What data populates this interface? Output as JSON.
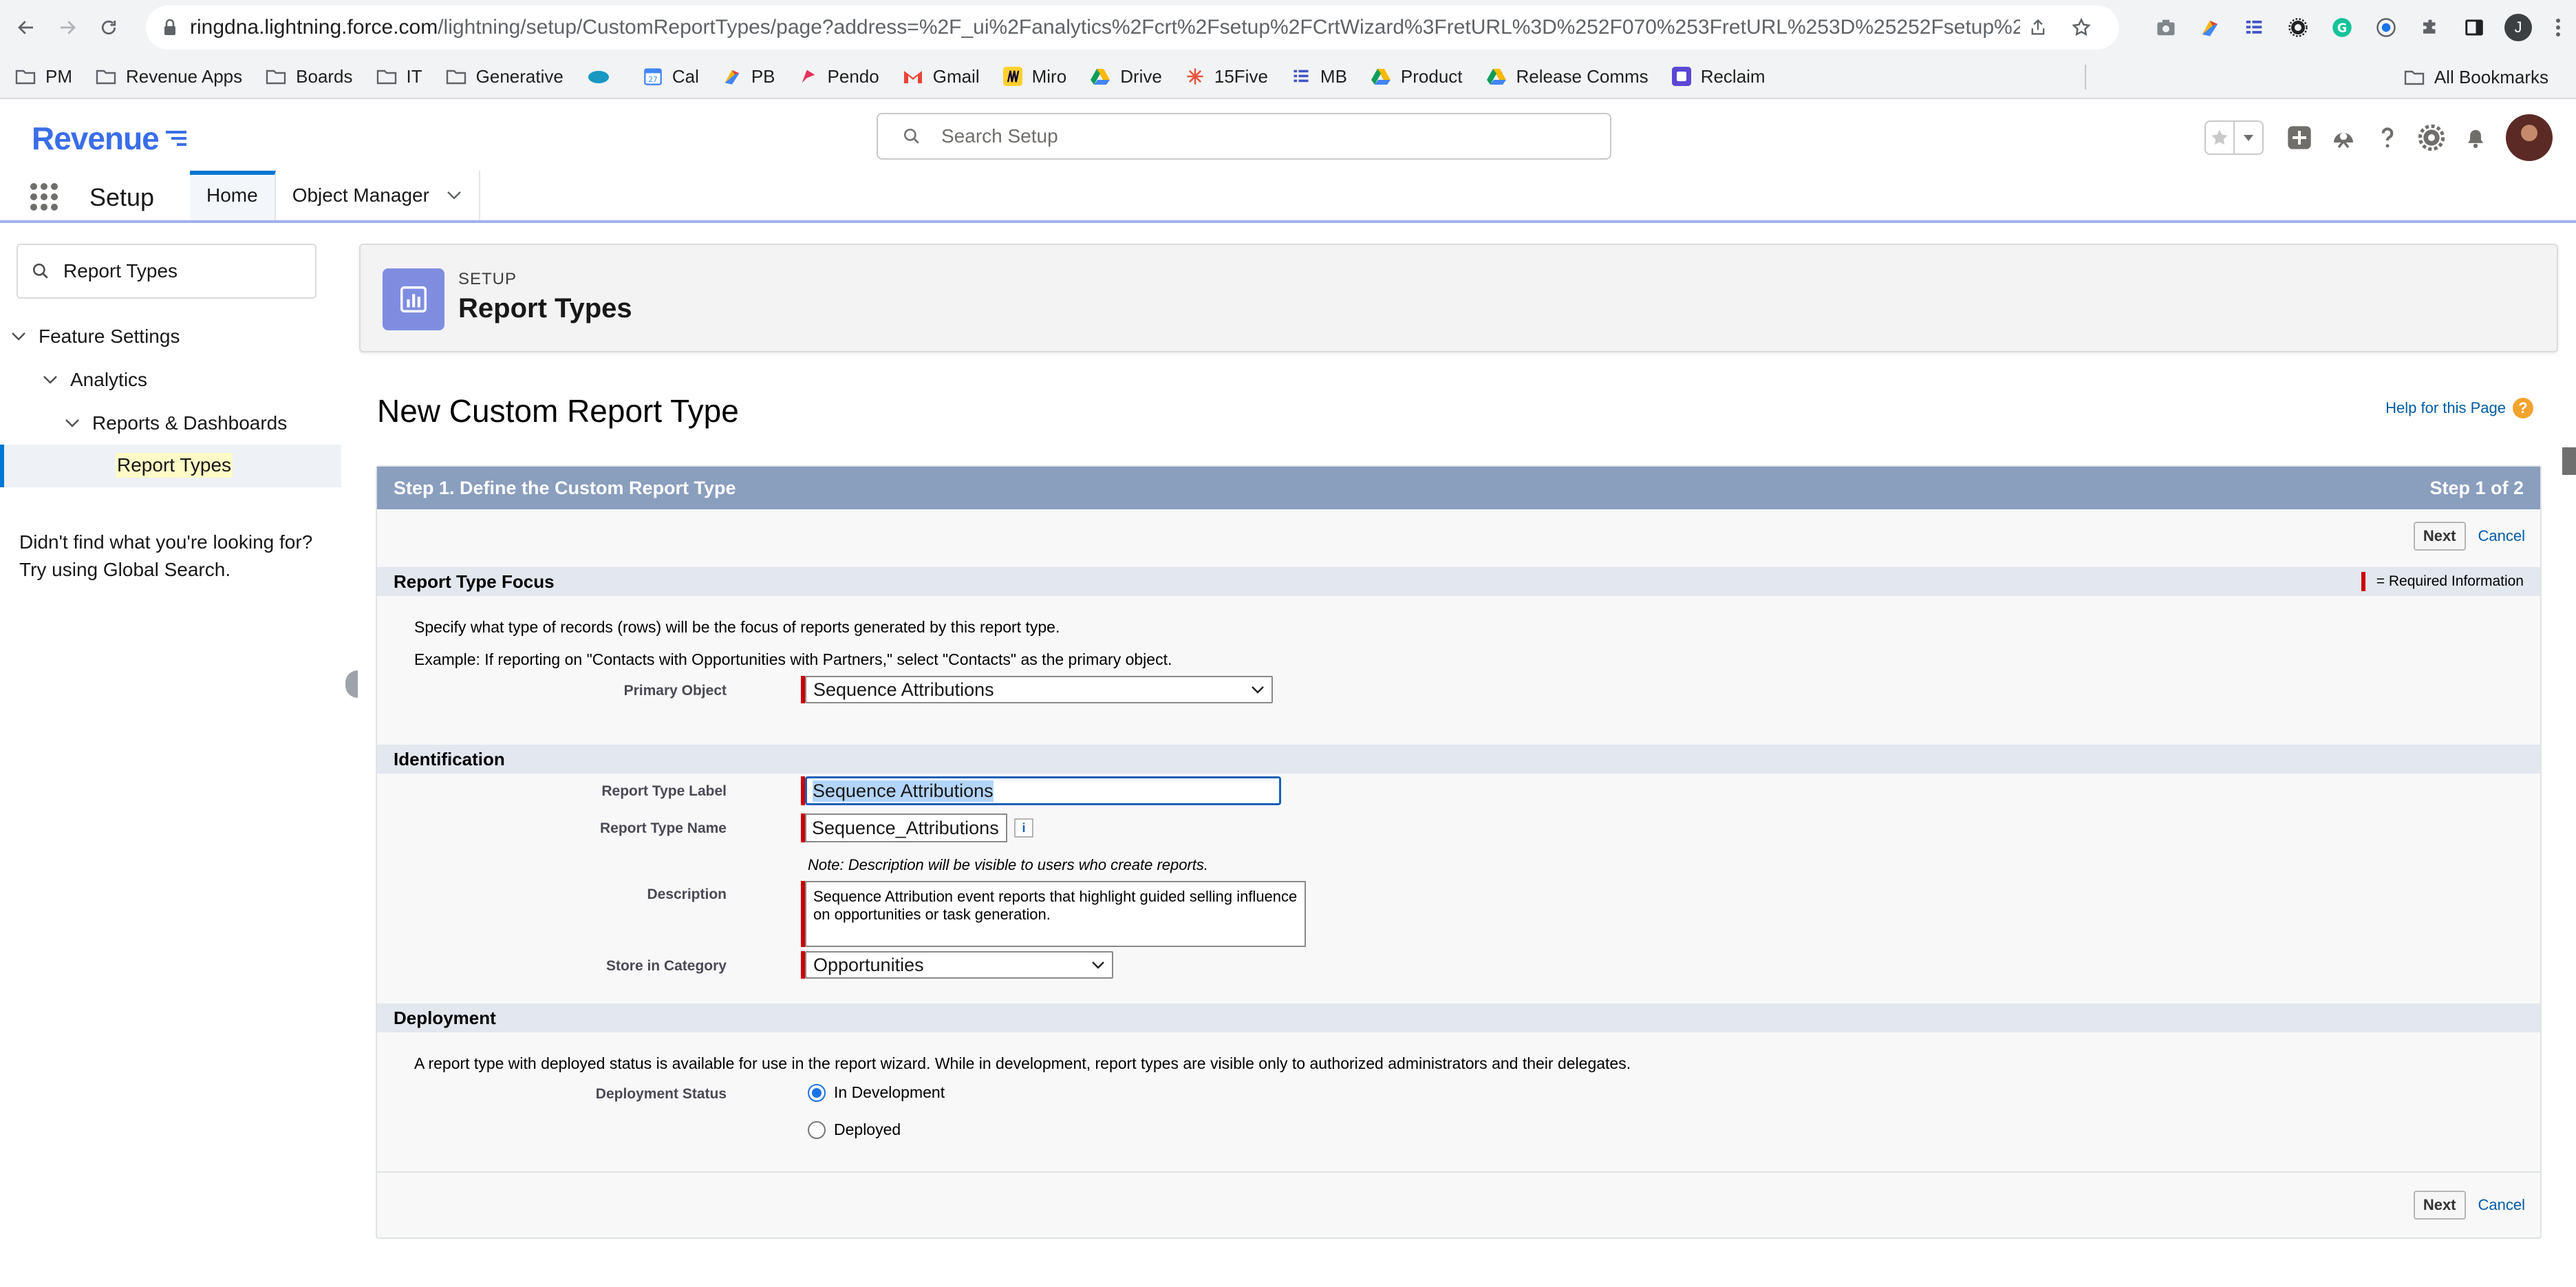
{
  "browser": {
    "url_host": "ringdna.lightning.force.com",
    "url_path": "/lightning/setup/CustomReportTypes/page?address=%2F_ui%2Fanalytics%2Fcrt%2Fsetup%2FCrtWizard%3FretURL%3D%252F070%253FretURL%253D%25252Fsetup%2...",
    "profile_initial": "J",
    "bookmarks": [
      {
        "label": "PM",
        "icon": "folder-icon"
      },
      {
        "label": "Revenue Apps",
        "icon": "folder-icon"
      },
      {
        "label": "Boards",
        "icon": "folder-icon"
      },
      {
        "label": "IT",
        "icon": "folder-icon"
      },
      {
        "label": "Generative",
        "icon": "folder-icon"
      },
      {
        "label": "",
        "icon": "salesforce-cloud-icon"
      },
      {
        "label": "Cal",
        "icon": "calendar-icon"
      },
      {
        "label": "PB",
        "icon": "pb-icon"
      },
      {
        "label": "Pendo",
        "icon": "pendo-icon"
      },
      {
        "label": "Gmail",
        "icon": "gmail-icon"
      },
      {
        "label": "Miro",
        "icon": "miro-icon"
      },
      {
        "label": "Drive",
        "icon": "drive-icon"
      },
      {
        "label": "15Five",
        "icon": "fifteen-five-icon"
      },
      {
        "label": "MB",
        "icon": "mb-icon"
      },
      {
        "label": "Product",
        "icon": "drive-icon"
      },
      {
        "label": "Release Comms",
        "icon": "drive-icon"
      },
      {
        "label": "Reclaim",
        "icon": "reclaim-icon"
      }
    ],
    "all_bookmarks": "All Bookmarks"
  },
  "header": {
    "logo_text": "Revenue",
    "search_placeholder": "Search Setup"
  },
  "app_nav": {
    "app_name": "Setup",
    "tabs": [
      {
        "label": "Home",
        "active": true
      },
      {
        "label": "Object Manager",
        "active": false
      }
    ]
  },
  "sidebar": {
    "quick_find_value": "Report Types",
    "tree": {
      "feature_settings": "Feature Settings",
      "analytics": "Analytics",
      "reports_dashboards": "Reports & Dashboards",
      "report_types": "Report Types"
    },
    "help_line1": "Didn't find what you're looking for?",
    "help_line2": "Try using Global Search."
  },
  "setup_header": {
    "eyebrow": "SETUP",
    "title": "Report Types"
  },
  "page": {
    "title": "New Custom Report Type",
    "help_link": "Help for this Page",
    "help_icon_glyph": "?"
  },
  "wizard": {
    "step_title": "Step 1. Define the Custom Report Type",
    "step_count": "Step 1 of 2",
    "next_label": "Next",
    "cancel_label": "Cancel",
    "required_info": "= Required Information",
    "focus": {
      "heading": "Report Type Focus",
      "desc1": "Specify what type of records (rows) will be the focus of reports generated by this report type.",
      "desc2": "Example: If reporting on \"Contacts with Opportunities with Partners,\" select \"Contacts\" as the primary object.",
      "primary_object_label": "Primary Object",
      "primary_object_value": "Sequence Attributions"
    },
    "identification": {
      "heading": "Identification",
      "label_label": "Report Type Label",
      "label_value": "Sequence Attributions",
      "name_label": "Report Type Name",
      "name_value": "Sequence_Attributions",
      "info_glyph": "i",
      "note": "Note: Description will be visible to users who create reports.",
      "description_label": "Description",
      "description_value": "Sequence Attribution event reports that highlight guided selling influence on opportunities or task generation.",
      "category_label": "Store in Category",
      "category_value": "Opportunities"
    },
    "deployment": {
      "heading": "Deployment",
      "desc": "A report type with deployed status is available for use in the report wizard. While in development, report types are visible only to authorized administrators and their delegates.",
      "status_label": "Deployment Status",
      "options": [
        {
          "label": "In Development",
          "checked": true
        },
        {
          "label": "Deployed",
          "checked": false
        }
      ]
    }
  },
  "colors": {
    "brand_blue": "#0176d3",
    "step_bar": "#8a9ebe",
    "required_red": "#cc0000",
    "setup_icon_bg": "#7f8de1"
  }
}
